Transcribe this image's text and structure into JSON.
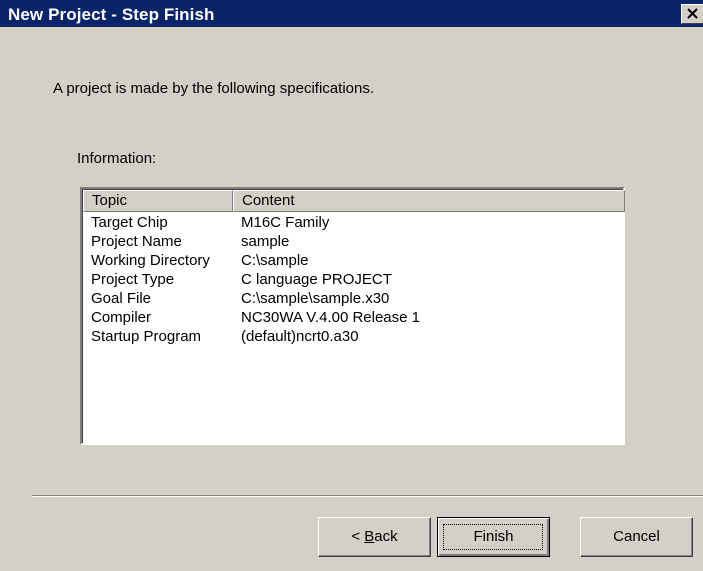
{
  "window": {
    "title": "New Project - Step Finish"
  },
  "intro_text": "A project is made by the following specifications.",
  "info_label": "Information:",
  "table": {
    "columns": [
      "Topic",
      "Content"
    ],
    "rows": [
      {
        "topic": "Target Chip",
        "content": "M16C Family"
      },
      {
        "topic": "Project Name",
        "content": "sample"
      },
      {
        "topic": "Working Directory",
        "content": "C:\\sample"
      },
      {
        "topic": "Project Type",
        "content": "C language PROJECT"
      },
      {
        "topic": "Goal File",
        "content": "C:\\sample\\sample.x30"
      },
      {
        "topic": "Compiler",
        "content": "NC30WA V.4.00 Release 1"
      },
      {
        "topic": "Startup Program",
        "content": "(default)ncrt0.a30"
      }
    ]
  },
  "buttons": {
    "back_prefix": "< ",
    "back_accel": "B",
    "back_rest": "ack",
    "finish": "Finish",
    "cancel": "Cancel"
  },
  "icons": {
    "close": "close-icon"
  },
  "colors": {
    "titlebar": "#0a246a",
    "face": "#d4d0c8"
  }
}
